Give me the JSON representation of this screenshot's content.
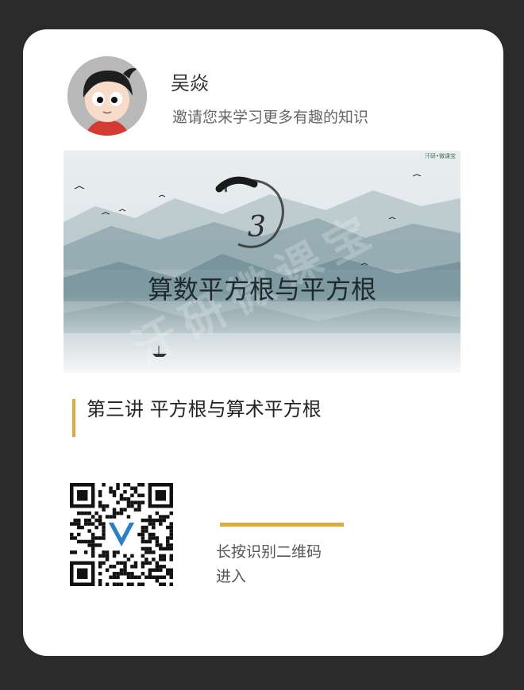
{
  "user": {
    "name": "吴焱",
    "invite": "邀请您来学习更多有趣的知识"
  },
  "banner": {
    "brand": "汗研•微课宝",
    "number": "3",
    "title": "算数平方根与平方根",
    "watermark": "汗研微课宝"
  },
  "lesson": {
    "title": "第三讲 平方根与算术平方根"
  },
  "qr": {
    "hint_line1": "长按识别二维码",
    "hint_line2": "进入"
  },
  "colors": {
    "background": "#2b2b2b",
    "card": "#ffffff",
    "accent": "#d9ad3c"
  }
}
